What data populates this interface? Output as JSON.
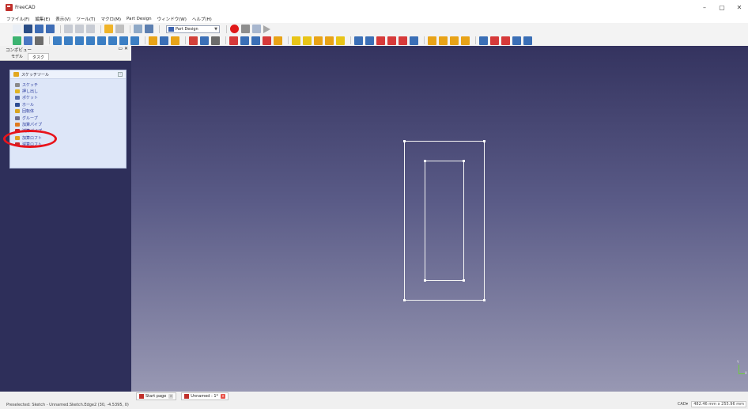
{
  "window": {
    "title": "FreeCAD",
    "controls": [
      "–",
      "▢",
      "✕"
    ]
  },
  "menu": [
    "ファイル(F)",
    "編集(E)",
    "表示(V)",
    "ツール(T)",
    "マクロ(M)",
    "Part Design",
    "ウィンドウ(W)",
    "ヘルプ(H)"
  ],
  "toolbar": {
    "workbench": "Part Design",
    "row1_icons": [
      {
        "name": "new-file-icon",
        "color": "#e9eef5"
      },
      {
        "name": "open-file-icon",
        "color": "#2a4d86"
      },
      {
        "name": "save-icon",
        "color": "#3d6cb5"
      },
      {
        "name": "save-as-icon",
        "color": "#3d6cb5"
      },
      {
        "name": "cut-icon",
        "color": "#c7cbd3"
      },
      {
        "name": "copy-icon",
        "color": "#c7cbd3"
      },
      {
        "name": "paste-icon",
        "color": "#c7cbd3"
      },
      {
        "name": "undo-icon",
        "color": "#f0b429"
      },
      {
        "name": "redo-icon",
        "color": "#bfbfbf"
      },
      {
        "name": "refresh-icon",
        "color": "#8fa9c7"
      },
      {
        "name": "whats-this-icon",
        "color": "#5c7fb0"
      }
    ],
    "row1_macro_icons": [
      {
        "name": "record-macro-icon",
        "color": "#e01919",
        "round": true
      },
      {
        "name": "stop-macro-icon",
        "color": "#8e8e8e"
      },
      {
        "name": "macros-icon",
        "color": "#a8b7cf"
      }
    ],
    "row2_icons": [
      {
        "name": "fit-all-icon",
        "color": "#3cb371"
      },
      {
        "name": "fit-selection-icon",
        "color": "#4a78c2"
      },
      {
        "name": "draw-style-icon",
        "color": "#6c6c6c"
      },
      {
        "name": "view-isometric-icon",
        "color": "#3c7fc4"
      },
      {
        "name": "view-front-icon",
        "color": "#3c7fc4"
      },
      {
        "name": "view-top-icon",
        "color": "#3c7fc4"
      },
      {
        "name": "view-right-icon",
        "color": "#3c7fc4"
      },
      {
        "name": "view-rear-icon",
        "color": "#3c7fc4"
      },
      {
        "name": "view-bottom-icon",
        "color": "#3c7fc4"
      },
      {
        "name": "view-left-icon",
        "color": "#3c7fc4"
      },
      {
        "name": "measure-icon",
        "color": "#3c7fc4"
      },
      {
        "name": "part-icon",
        "color": "#e8a317"
      },
      {
        "name": "group-icon",
        "color": "#3b6fb6"
      },
      {
        "name": "body-icon",
        "color": "#e8a317"
      },
      {
        "name": "create-sketch-icon",
        "color": "#d2413a"
      },
      {
        "name": "validate-sketch-icon",
        "color": "#3b6fb6"
      },
      {
        "name": "map-sketch-icon",
        "color": "#6c6c6c"
      },
      {
        "name": "datum-point-icon",
        "color": "#d63a3a"
      },
      {
        "name": "datum-line-icon",
        "color": "#3b6fb6"
      },
      {
        "name": "datum-plane-icon",
        "color": "#3b6fb6"
      },
      {
        "name": "local-cs-icon",
        "color": "#d63a3a"
      },
      {
        "name": "shape-binder-icon",
        "color": "#e8a317"
      },
      {
        "name": "pad-icon",
        "color": "#e8c417"
      },
      {
        "name": "revolution-icon",
        "color": "#e8c417"
      },
      {
        "name": "additive-loft-icon",
        "color": "#e8a317"
      },
      {
        "name": "additive-pipe-icon",
        "color": "#e8a317"
      },
      {
        "name": "additive-primitive-icon",
        "color": "#e8c417"
      },
      {
        "name": "pocket-icon",
        "color": "#3b6fb6"
      },
      {
        "name": "hole-icon",
        "color": "#3b6fb6"
      },
      {
        "name": "groove-icon",
        "color": "#d63a3a"
      },
      {
        "name": "subtractive-loft-icon",
        "color": "#d63a3a"
      },
      {
        "name": "subtractive-pipe-icon",
        "color": "#d63a3a"
      },
      {
        "name": "subtractive-primitive-icon",
        "color": "#3b6fb6"
      },
      {
        "name": "mirrored-icon",
        "color": "#e8a317"
      },
      {
        "name": "linear-pattern-icon",
        "color": "#e8a317"
      },
      {
        "name": "polar-pattern-icon",
        "color": "#e8a317"
      },
      {
        "name": "multi-transform-icon",
        "color": "#e8a317"
      },
      {
        "name": "fillet-icon",
        "color": "#3b6fb6"
      },
      {
        "name": "chamfer-icon",
        "color": "#d63a3a"
      },
      {
        "name": "draft-icon",
        "color": "#d63a3a"
      },
      {
        "name": "thickness-icon",
        "color": "#3b6fb6"
      },
      {
        "name": "boolean-icon",
        "color": "#3b6fb6"
      }
    ]
  },
  "combo_view": {
    "title": "コンボビュー",
    "header_buttons": "▭ ✕",
    "tabs": [
      "モデル",
      "タスク"
    ],
    "active_tab": 1,
    "task_panel_title": "スケッチツール",
    "task_items": [
      {
        "label": "スケッチ",
        "icon_color": "#8a8a8a"
      },
      {
        "label": "押し出し",
        "icon_color": "#e0b323"
      },
      {
        "label": "ポケット",
        "icon_color": "#5a6fa7"
      },
      {
        "label": "ホール",
        "icon_color": "#2f4d92"
      },
      {
        "label": "回転体",
        "icon_color": "#d9a41f"
      },
      {
        "label": "グループ",
        "icon_color": "#6f6f8f"
      },
      {
        "label": "加算パイプ",
        "icon_color": "#e07a1f"
      },
      {
        "label": "減算パイプ",
        "icon_color": "#c52a2a"
      },
      {
        "label": "加算ロフト",
        "icon_color": "#e0a21f"
      },
      {
        "label": "減算ロフト",
        "icon_color": "#c52a2a"
      }
    ]
  },
  "viewport": {
    "axis_labels": [
      "X",
      "Y"
    ]
  },
  "document_tabs": [
    {
      "label": "Start page",
      "active": false
    },
    {
      "label": "Unnamed : 1*",
      "active": true
    }
  ],
  "status": {
    "text": "Preselected: Sketch - Unnamed.Sketch.Edge2 (30, -4.5395, 0)",
    "nav_style": "CAD▾",
    "dimensions": "482.46 mm x 255.96 mm"
  }
}
